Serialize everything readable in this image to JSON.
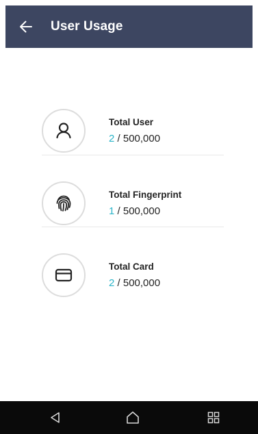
{
  "app_bar": {
    "title": "User Usage",
    "back_icon": "arrow-left-icon"
  },
  "stats": [
    {
      "label": "Total User",
      "current": "2",
      "separator": " / ",
      "max": "500,000",
      "icon": "user-icon"
    },
    {
      "label": "Total Fingerprint",
      "current": "1",
      "separator": " / ",
      "max": "500,000",
      "icon": "fingerprint-icon"
    },
    {
      "label": "Total Card",
      "current": "2",
      "separator": " / ",
      "max": "500,000",
      "icon": "card-icon"
    }
  ],
  "nav_bar": {
    "back_icon": "nav-back-icon",
    "home_icon": "nav-home-icon",
    "recent_icon": "nav-recent-apps-icon"
  },
  "colors": {
    "app_bar": "#3d4661",
    "accent": "#2ab4c8",
    "nav_bar": "#0a0a0a"
  }
}
